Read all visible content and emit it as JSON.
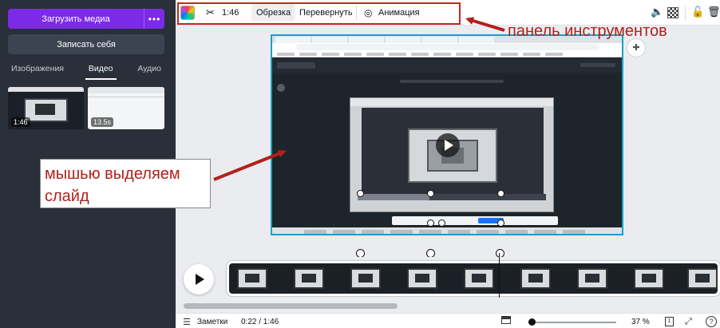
{
  "sidebar": {
    "upload_label": "Загрузить медиа",
    "upload_more": "•••",
    "record_label": "Записать себя",
    "tabs": [
      {
        "label": "Изображения"
      },
      {
        "label": "Видео",
        "active": true
      },
      {
        "label": "Аудио"
      }
    ],
    "thumbnails": [
      {
        "duration": "1:46"
      },
      {
        "duration": "13.5s"
      }
    ]
  },
  "toolbar": {
    "duration": "1:46",
    "trim_label": "Обрезка",
    "flip_label": "Перевернуть",
    "animation_label": "Анимация"
  },
  "annotations": {
    "toolbar_note": "панель инструментов",
    "slide_note_line1": "мышью выделяем",
    "slide_note_line2": "слайд"
  },
  "bottombar": {
    "notes_label": "Заметки",
    "time_progress": "0:22 / 1:46",
    "zoom_label": "37 %",
    "pages_count": "1",
    "help_label": "?"
  },
  "colors": {
    "sidebar_bg": "#293039",
    "accent_purple": "#7d2ae8",
    "annotation_red": "#b3201c",
    "selection_blue": "#1aa0c9"
  }
}
